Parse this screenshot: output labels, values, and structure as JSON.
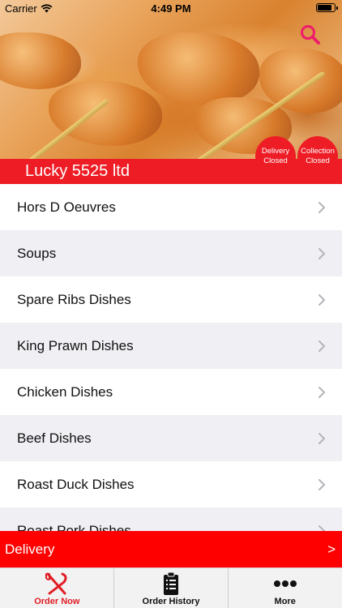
{
  "status_bar": {
    "carrier": "Carrier",
    "time": "4:49 PM"
  },
  "restaurant": {
    "name": "Lucky 5525 ltd",
    "delivery_status": [
      "Delivery",
      "Closed"
    ],
    "collection_status": [
      "Collection",
      "Closed"
    ]
  },
  "menu": {
    "categories": [
      "Hors D Oeuvres",
      "Soups",
      "Spare Ribs Dishes",
      "King Prawn Dishes",
      "Chicken Dishes",
      "Beef Dishes",
      "Roast Duck Dishes",
      "Roast Pork Dishes"
    ]
  },
  "order_bar": {
    "label": "Delivery",
    "arrow": ">"
  },
  "tabs": [
    {
      "label": "Order Now",
      "icon": "fork-knife-icon",
      "active": true
    },
    {
      "label": "Order History",
      "icon": "clipboard-icon",
      "active": false
    },
    {
      "label": "More",
      "icon": "more-dots-icon",
      "active": false
    }
  ],
  "colors": {
    "brand_red": "#ee1c25",
    "bar_red": "#ff0000",
    "active_tab": "#e11d24"
  }
}
